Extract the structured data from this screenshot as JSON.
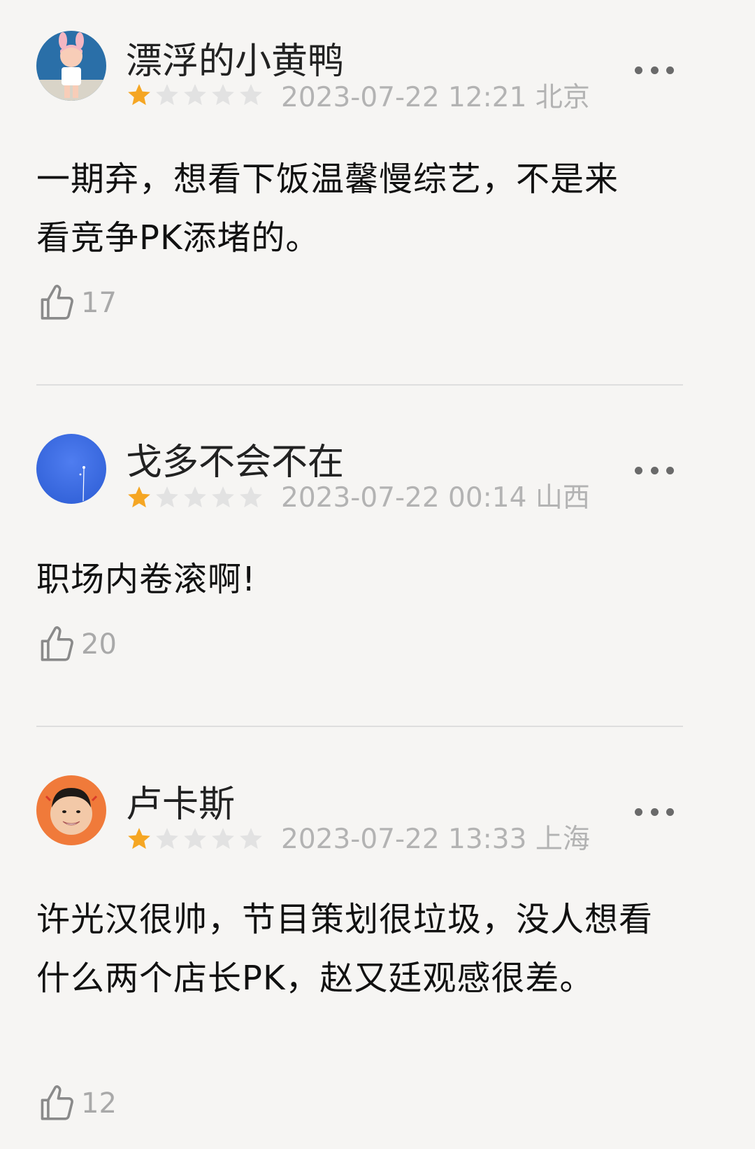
{
  "reviews": [
    {
      "username": "漂浮的小黄鸭",
      "rating": 1,
      "rating_max": 5,
      "date": "2023-07-22 12:21",
      "location": "北京",
      "content": "一期弃，想看下饭温馨慢综艺，不是来看竞争PK添堵的。",
      "likes": "17",
      "avatar_icon": "avatar-girl-bunny-ears"
    },
    {
      "username": "戈多不会不在",
      "rating": 1,
      "rating_max": 5,
      "date": "2023-07-22 00:14",
      "location": "山西",
      "content": "职场内卷滚啊!",
      "likes": "20",
      "avatar_icon": "avatar-blue-sky"
    },
    {
      "username": "卢卡斯",
      "rating": 1,
      "rating_max": 5,
      "date": "2023-07-22 13:33",
      "location": "上海",
      "content": "许光汉很帅，节目策划很垃圾，没人想看什么两个店长PK，赵又廷观感很差。",
      "likes": "12",
      "avatar_icon": "avatar-man-orange"
    }
  ],
  "colors": {
    "background": "#f6f5f3",
    "star_active": "#f5a623",
    "star_inactive": "#e2e2e2",
    "meta_text": "#b3b3b3",
    "divider": "#dedede"
  }
}
